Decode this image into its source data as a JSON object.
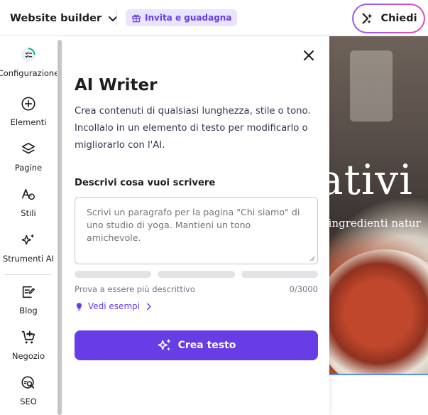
{
  "topbar": {
    "site_switch_label": "Website builder",
    "invite_label": "Invita e guadagna",
    "ask_label": "Chiedi"
  },
  "sidebar": {
    "items": [
      {
        "label": "Configurazione",
        "icon": "setup-progress-icon"
      },
      {
        "label": "Elementi",
        "icon": "add-circle-icon"
      },
      {
        "label": "Pagine",
        "icon": "layers-icon"
      },
      {
        "label": "Stili",
        "icon": "styles-icon"
      },
      {
        "label": "Strumenti AI",
        "icon": "sparkles-icon"
      },
      {
        "label": "Blog",
        "icon": "blog-icon"
      },
      {
        "label": "Negozio",
        "icon": "cart-add-icon"
      },
      {
        "label": "SEO",
        "icon": "seo-search-icon"
      }
    ]
  },
  "preview": {
    "hero_word": "ativi",
    "hero_sub": "e ingredienti natur"
  },
  "ai_writer": {
    "title": "AI Writer",
    "description": "Crea contenuti di qualsiasi lunghezza, stile o tono. Incollalo in un elemento di testo per modificarlo o migliorarlo con l'AI.",
    "field_label": "Descrivi cosa vuoi scrivere",
    "prompt_placeholder": "Scrivi un paragrafo per la pagina \"Chi siamo\" di uno studio di yoga. Mantieni un tono amichevole.",
    "hint": "Prova a essere più descrittivo",
    "counter": "0/3000",
    "examples_label": "Vedi esempi",
    "create_label": "Crea testo"
  },
  "colors": {
    "accent": "#673de6",
    "invite_bg": "#ebe4ff",
    "text": "#1d1e20"
  }
}
